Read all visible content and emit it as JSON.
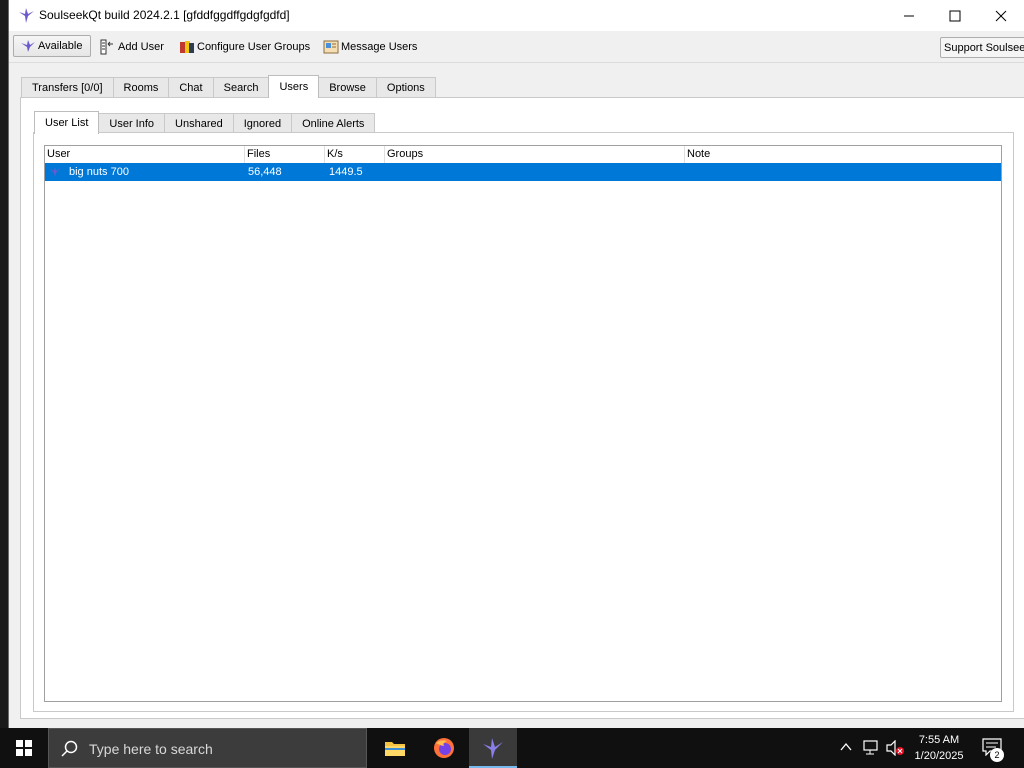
{
  "window": {
    "title": "SoulseekQt build 2024.2.1 [gfddfggdffgdgfgdfd]"
  },
  "toolbar": {
    "status_label": "Available",
    "add_user_label": "Add User",
    "configure_groups_label": "Configure User Groups",
    "message_users_label": "Message Users",
    "support_label": "Support Soulseek"
  },
  "main_tabs": [
    {
      "label": "Transfers [0/0]"
    },
    {
      "label": "Rooms"
    },
    {
      "label": "Chat"
    },
    {
      "label": "Search"
    },
    {
      "label": "Users",
      "active": true
    },
    {
      "label": "Browse"
    },
    {
      "label": "Options"
    }
  ],
  "sub_tabs": [
    {
      "label": "User List",
      "active": true
    },
    {
      "label": "User Info"
    },
    {
      "label": "Unshared"
    },
    {
      "label": "Ignored"
    },
    {
      "label": "Online Alerts"
    }
  ],
  "user_table": {
    "columns": [
      "User",
      "Files",
      "K/s",
      "Groups",
      "Note"
    ],
    "rows": [
      {
        "user": "big nuts 700",
        "files": "56,448",
        "speed": "1449.5",
        "groups": "",
        "note": "",
        "selected": true
      }
    ]
  },
  "taskbar": {
    "search_placeholder": "Type here to search",
    "time": "7:55 AM",
    "date": "1/20/2025",
    "notification_count": "2",
    "apps": [
      "file-explorer-icon",
      "firefox-icon",
      "soulseek-icon"
    ]
  },
  "colors": {
    "selection": "#0078d7",
    "taskbar": "#101010",
    "window_bg": "#f0f0f0"
  }
}
